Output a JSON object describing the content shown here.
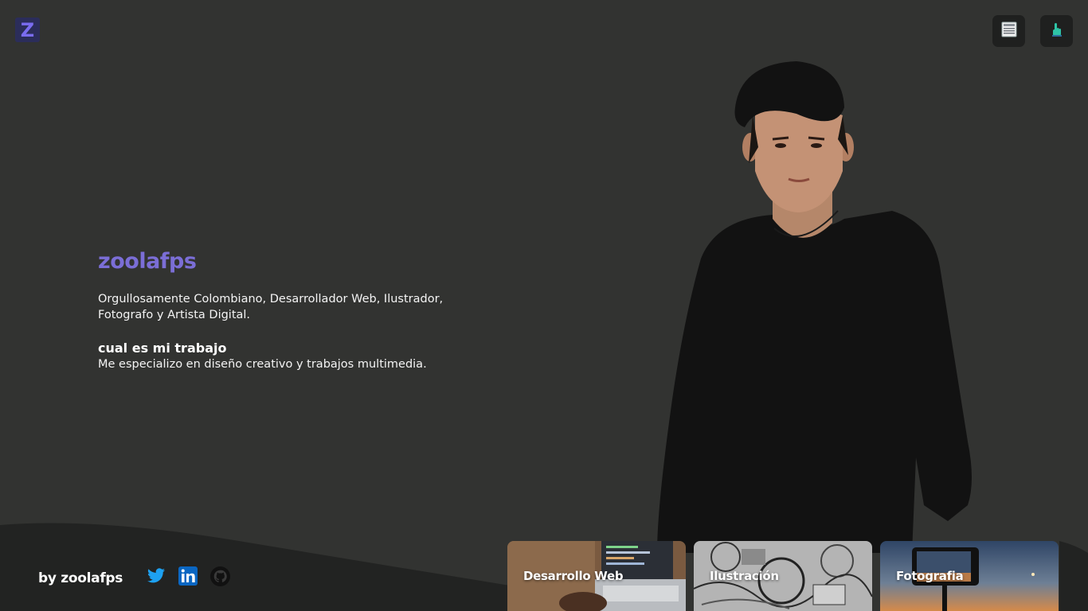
{
  "header": {
    "logo_letter": "Z",
    "buttons": [
      {
        "name": "document-icon"
      },
      {
        "name": "pointer-hand-icon"
      }
    ]
  },
  "hero": {
    "name": "zoolafps",
    "description": "Orgullosamente Colombiano, Desarrollador Web, Ilustrador, Fotografo y Artista Digital.",
    "work_heading": "cual es mi trabajo",
    "work_text": "Me especializo en diseño creativo y trabajos multimedia."
  },
  "footer": {
    "byline": "by zoolafps",
    "social": [
      {
        "name": "twitter-icon",
        "color": "#1da1f2"
      },
      {
        "name": "linkedin-icon",
        "color": "#0a66c2"
      },
      {
        "name": "github-icon",
        "color": "#111111"
      }
    ]
  },
  "cards": [
    {
      "label": "Desarrollo Web"
    },
    {
      "label": "Ilustración"
    },
    {
      "label": "Fotografia"
    }
  ],
  "colors": {
    "background": "#323331",
    "accent": "#7b6ed6",
    "footer": "#222322"
  }
}
